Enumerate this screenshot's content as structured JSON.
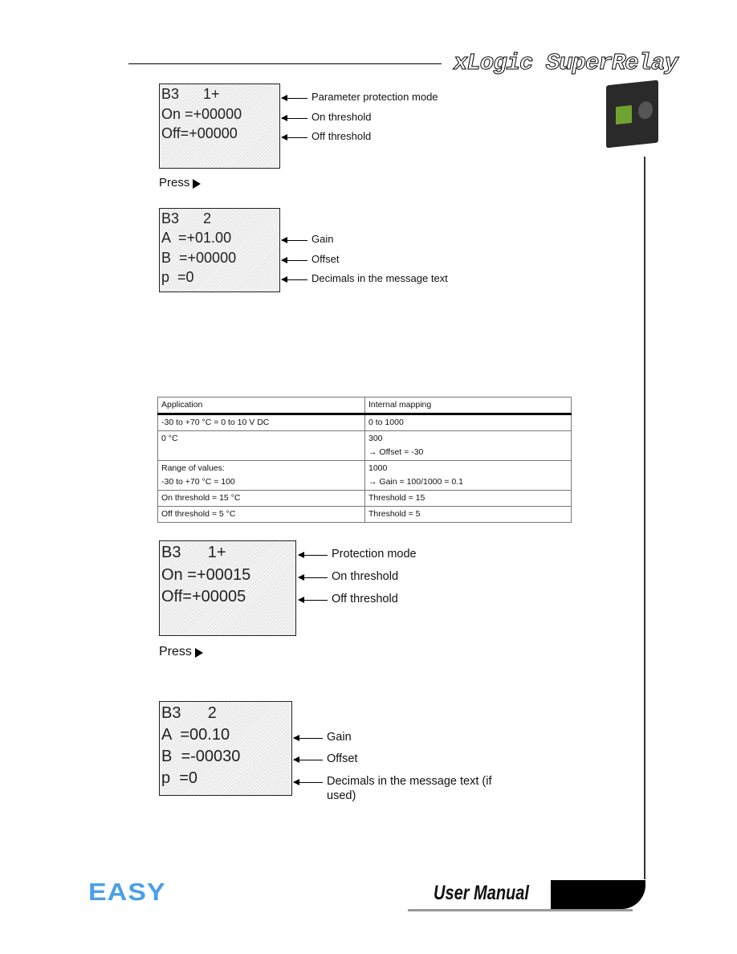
{
  "header": {
    "brand": "xLogic SuperRelay"
  },
  "screens": [
    {
      "lines": [
        "B3      1+",
        "On =+00000",
        "Off=+00000",
        ""
      ],
      "labels": [
        "Parameter protection mode",
        "On threshold",
        "Off threshold"
      ]
    },
    {
      "lines": [
        "B3      2",
        "A  =+01.00",
        "B  =+00000",
        "p  =0"
      ],
      "labels": [
        "Gain",
        "Offset",
        "Decimals in the message text"
      ]
    },
    {
      "lines": [
        "B3      1+",
        "On =+00015",
        "Off=+00005",
        ""
      ],
      "labels": [
        "Protection mode",
        "On threshold",
        "Off threshold"
      ]
    },
    {
      "lines": [
        "B3      2",
        "A  =00.10",
        "B  =-00030",
        "p  =0"
      ],
      "labels": [
        "Gain",
        "Offset",
        "Decimals in the message text (if",
        "used)"
      ]
    }
  ],
  "press_label": "Press",
  "table": {
    "headers": [
      "Application",
      "Internal mapping"
    ],
    "rows": [
      [
        "-30 to +70 °C = 0 to 10 V DC",
        "0 to 1000"
      ],
      [
        "0 °C",
        "300",
        "→ Offset = -30"
      ],
      [
        "Range of values:",
        "-30 to +70 °C = 100",
        "1000",
        "→ Gain = 100/1000 = 0.1"
      ],
      [
        "On threshold = 15 °C",
        "Threshold = 15"
      ],
      [
        "Off threshold = 5 °C",
        "Threshold = 5"
      ]
    ]
  },
  "footer": {
    "logo": "EASY",
    "manual": "User Manual"
  }
}
